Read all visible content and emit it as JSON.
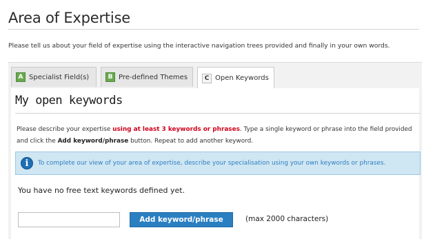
{
  "page": {
    "title": "Area of Expertise",
    "intro": "Please tell us about your field of expertise using the interactive navigation trees provided and finally in your own words."
  },
  "tabs": [
    {
      "badge": "A",
      "label": "Specialist Field(s)",
      "active": false
    },
    {
      "badge": "B",
      "label": "Pre-defined Themes",
      "active": false
    },
    {
      "badge": "C",
      "label": "Open Keywords",
      "active": true
    }
  ],
  "section": {
    "title": "My open keywords",
    "desc_part1": "Please describe your expertise ",
    "desc_highlight": "using at least 3 keywords or phrases",
    "desc_part2": ". Type a single keyword or phrase into the field provided and click the ",
    "desc_bold": "Add keyword/phrase",
    "desc_part3": " button. Repeat to add another keyword.",
    "info": "To complete our view of your area of expertise, describe your specialisation using your own keywords or phrases.",
    "empty_note": "You have no free text keywords defined yet."
  },
  "form": {
    "input_value": "",
    "add_label": "Add keyword/phrase",
    "max_note": "(max 2000 characters)"
  },
  "colors": {
    "accent": "#2a7fc1",
    "highlight_red": "#d0021b",
    "info_bg": "#cfe6f3",
    "badge_green": "#6aa84f"
  }
}
